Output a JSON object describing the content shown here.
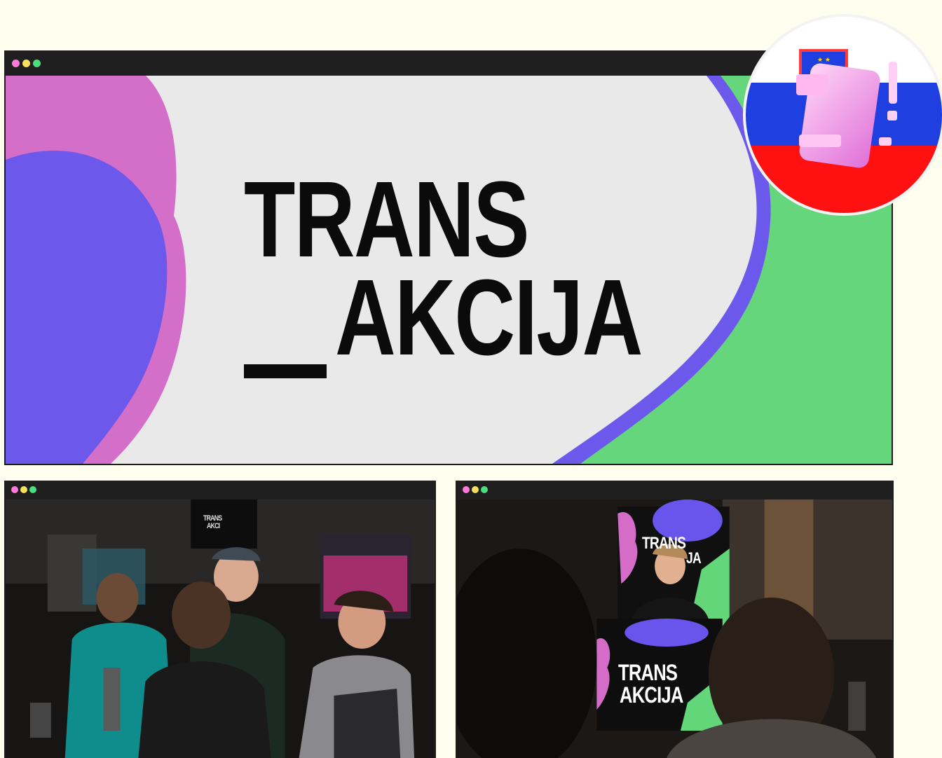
{
  "window_dots": [
    "#ff7ad9",
    "#f6e05e",
    "#4ade80"
  ],
  "hero": {
    "logo_line1": "TRANS",
    "logo_line2": "AKCIJA",
    "colors": {
      "pink": "#d46cc8",
      "blue": "#6a55ec",
      "green": "#63d67a",
      "grey": "#e9e9e9",
      "text": "#0b0b0b"
    }
  },
  "badge": {
    "icon": "slovenia-flag-sticker-icon",
    "flag_colors": [
      "#ffffff",
      "#1f3fe0",
      "#ff1111"
    ]
  },
  "photos": {
    "left": {
      "banner_text_1": "TRANS",
      "banner_text_2": "AKCI"
    },
    "right": {
      "banner_top_1": "TRANS",
      "banner_top_2": "JA",
      "podium_line1": "TRANS",
      "podium_line2": "AKCIJA"
    }
  }
}
